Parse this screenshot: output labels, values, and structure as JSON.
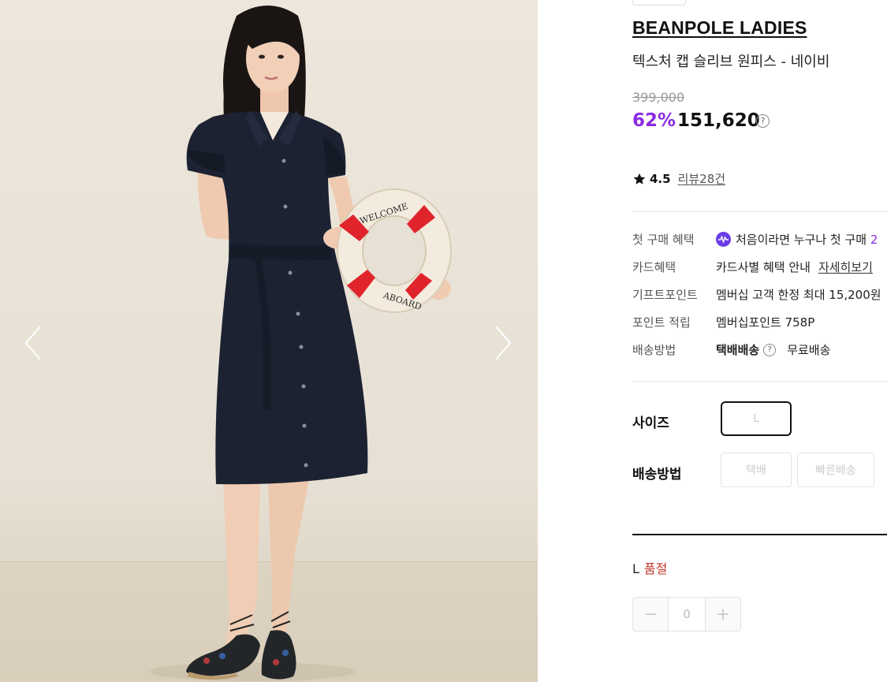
{
  "gallery": {
    "lifebuoy_text_top": "WELCOME",
    "lifebuoy_text_bottom": "ABOARD"
  },
  "product": {
    "brand": "BEANPOLE LADIES",
    "name": "텍스처 캡 슬리브 원피스 - 네이비",
    "original_price": "399,000",
    "discount": "62%",
    "sale_price": "151,620",
    "price_help": "?",
    "rating": "4.5",
    "reviews": "리뷰28건"
  },
  "benefits": [
    {
      "label": "첫 구매 혜택",
      "value": "처음이라면 누구나 첫 구매",
      "accent": "2"
    },
    {
      "label": "카드혜택",
      "value": "카드사별 혜택 안내",
      "link": "자세히보기"
    },
    {
      "label": "기프트포인트",
      "value": "멤버십 고객 한정 최대 15,200원"
    },
    {
      "label": "포인트 적립",
      "value": "멤버십포인트 758P"
    },
    {
      "label": "배송방법",
      "value": "택배배송",
      "help": "?",
      "extra": "무료배송"
    }
  ],
  "options": {
    "size_label": "사이즈",
    "sizes": [
      "L"
    ],
    "shipping_label": "배송방법",
    "shipping_options": [
      "택배",
      "빠른배송"
    ]
  },
  "selection": {
    "size": "L",
    "status": "품절",
    "quantity": "0",
    "minus": "−",
    "plus": "+"
  },
  "colors": {
    "accent": "#8a2be2",
    "soldout": "#c0392b",
    "dress": "#1c2232",
    "lifebuoy_red": "#e0242b"
  }
}
